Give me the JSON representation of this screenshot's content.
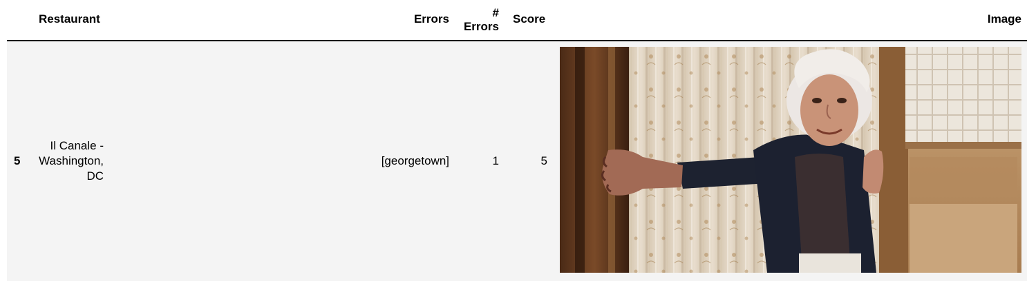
{
  "table": {
    "headers": {
      "restaurant": "Restaurant",
      "errors": "Errors",
      "num_errors_line1": "#",
      "num_errors_line2": "Errors",
      "score": "Score",
      "image": "Image"
    },
    "rows": [
      {
        "index": "5",
        "restaurant_line1": "Il Canale -",
        "restaurant_line2": "Washington,",
        "restaurant_line3": "DC",
        "errors": "[georgetown]",
        "num_errors": "1",
        "score": "5",
        "image_subject": "elderly-woman-in-doorway-photo"
      }
    ]
  },
  "colors": {
    "row_background": "#f4f4f4",
    "header_rule": "#000000"
  }
}
